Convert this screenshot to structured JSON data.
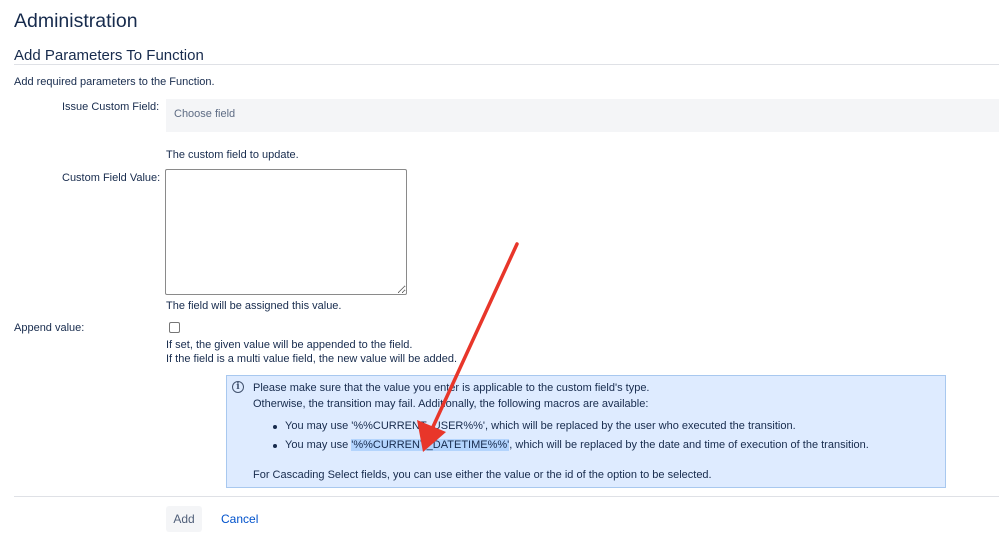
{
  "page": {
    "title": "Administration",
    "section_title": "Add Parameters To Function",
    "description": "Add required parameters to the Function."
  },
  "form": {
    "issue_custom_field": {
      "label": "Issue Custom Field:",
      "placeholder": "Choose field",
      "help": "The custom field to update."
    },
    "custom_field_value": {
      "label": "Custom Field Value:",
      "value": "",
      "help": "The field will be assigned this value."
    },
    "append_value": {
      "label": "Append value:",
      "checked": false,
      "help_line1": "If set, the given value will be appended to the field.",
      "help_line2": "If the field is a multi value field, the new value will be added."
    }
  },
  "info_box": {
    "icon": "info-icon",
    "line1": "Please make sure that the value you enter is applicable to the custom field's type.",
    "line2": "Otherwise, the transition may fail. Additionally, the following macros are available:",
    "bullet1": {
      "prefix": "You may use ",
      "macro": "'%%CURRENT_USER%%'",
      "suffix": ", which will be replaced by the user who executed the transition."
    },
    "bullet2": {
      "prefix": "You may use ",
      "macro": "'%%CURRENT_DATETIME%%'",
      "suffix": ", which will be replaced by the date and time of execution of the transition."
    },
    "footer": "For Cascading Select fields, you can use either the value or the id of the option to be selected."
  },
  "actions": {
    "add_label": "Add",
    "cancel_label": "Cancel"
  },
  "colors": {
    "text": "#172b4d",
    "link": "#0052cc",
    "info_background": "#deebff",
    "highlight": "#b3d4fd",
    "annotation_arrow": "#e8362a"
  }
}
